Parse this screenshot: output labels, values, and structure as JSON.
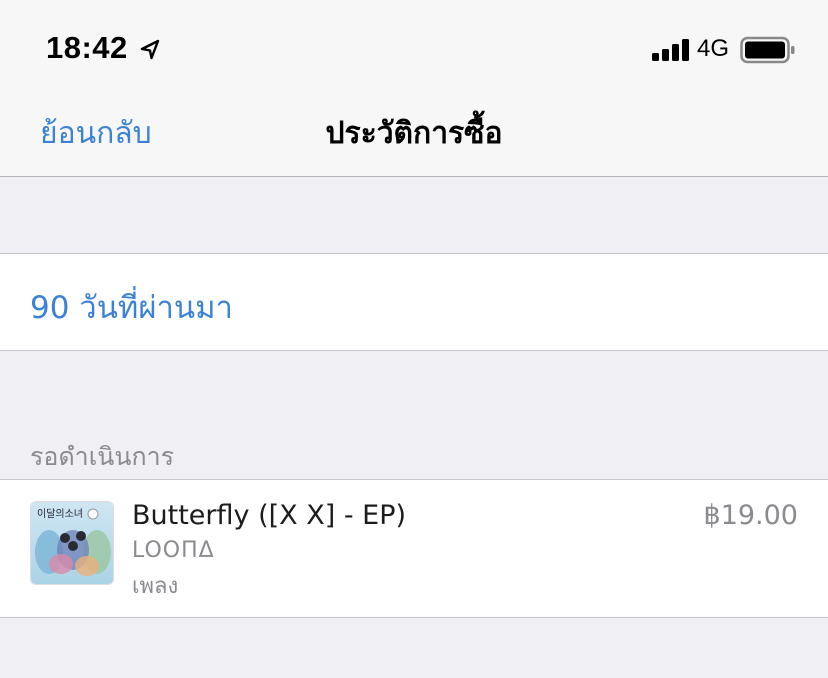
{
  "status_bar": {
    "time": "18:42",
    "network": "4G",
    "icons": [
      "location-arrow-icon",
      "signal-bars-icon",
      "battery-icon"
    ]
  },
  "nav": {
    "back_label": "ย้อนกลับ",
    "title": "ประวัติการซื้อ"
  },
  "period": {
    "label": "90 วันที่ผ่านมา"
  },
  "pending_section": {
    "header": "รอดำเนินการ",
    "items": [
      {
        "title": "Butterfly ([X X] - EP)",
        "artist": "LOOΠΔ",
        "type": "เพลง",
        "price": "฿19.00",
        "artwork_text": "이달의소녀"
      }
    ]
  },
  "colors": {
    "accent": "#3b82d6",
    "secondary_text": "#8a8a8f",
    "background": "#efeff4"
  }
}
